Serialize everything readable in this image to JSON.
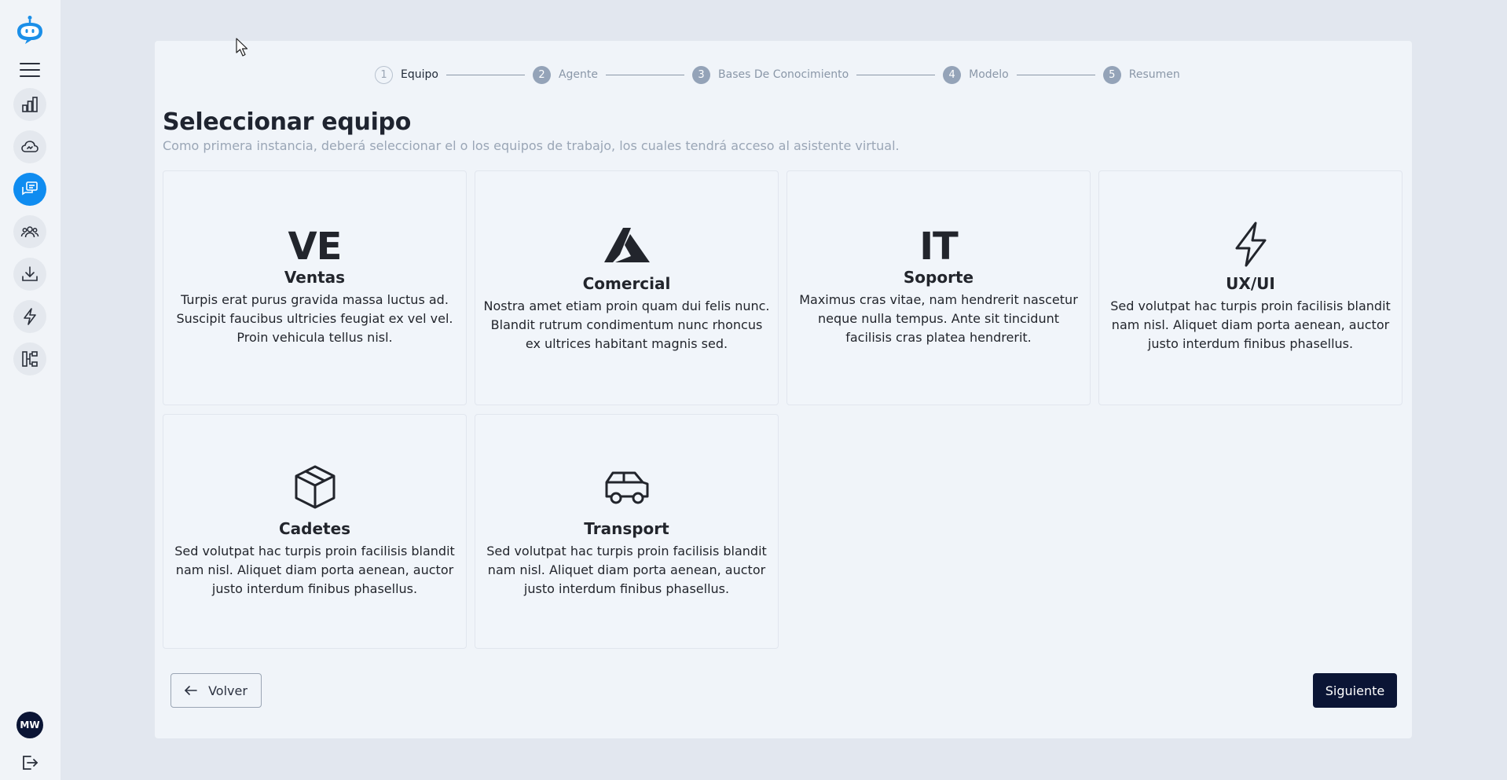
{
  "sidebar": {
    "items": [
      {
        "name": "bar-chart-icon"
      },
      {
        "name": "cloud-icon"
      },
      {
        "name": "chat-icon",
        "active": true
      },
      {
        "name": "users-icon"
      },
      {
        "name": "download-icon"
      },
      {
        "name": "lightning-icon"
      },
      {
        "name": "flow-icon"
      }
    ],
    "avatar_initials": "MW",
    "accent_color": "#0f8cf0"
  },
  "stepper": {
    "steps": [
      {
        "number": "1",
        "label": "Equipo"
      },
      {
        "number": "2",
        "label": "Agente"
      },
      {
        "number": "3",
        "label": "Bases De Conocimiento"
      },
      {
        "number": "4",
        "label": "Modelo"
      },
      {
        "number": "5",
        "label": "Resumen"
      }
    ]
  },
  "page": {
    "title": "Seleccionar equipo",
    "subtitle": "Como primera instancia, deberá seleccionar el o los equipos de trabajo, los cuales tendrá acceso al asistente virtual."
  },
  "teams": [
    {
      "icon": "VE",
      "name": "Ventas",
      "description": "Turpis erat purus gravida massa luctus ad. Suscipit faucibus ultricies feugiat ex vel vel. Proin vehicula tellus nisl."
    },
    {
      "icon": "azure-logo-icon",
      "name": "Comercial",
      "description": "Nostra amet etiam proin quam dui felis nunc. Blandit rutrum condimentum nunc rhoncus ex ultrices habitant magnis sed."
    },
    {
      "icon": "IT",
      "name": "Soporte",
      "description": "Maximus cras vitae, nam hendrerit nascetur neque nulla tempus. Ante sit tincidunt facilisis cras platea hendrerit."
    },
    {
      "icon": "lightning-icon",
      "name": "UX/UI",
      "description": "Sed volutpat hac turpis proin facilisis blandit nam nisl. Aliquet diam porta aenean, auctor justo interdum finibus phasellus."
    },
    {
      "icon": "box-icon",
      "name": "Cadetes",
      "description": "Sed volutpat hac turpis proin facilisis blandit nam nisl. Aliquet diam porta aenean, auctor justo interdum finibus phasellus."
    },
    {
      "icon": "car-icon",
      "name": "Transport",
      "description": "Sed volutpat hac turpis proin facilisis blandit nam nisl. Aliquet diam porta aenean, auctor justo interdum finibus phasellus."
    }
  ],
  "actions": {
    "back_label": "Volver",
    "next_label": "Siguiente"
  }
}
